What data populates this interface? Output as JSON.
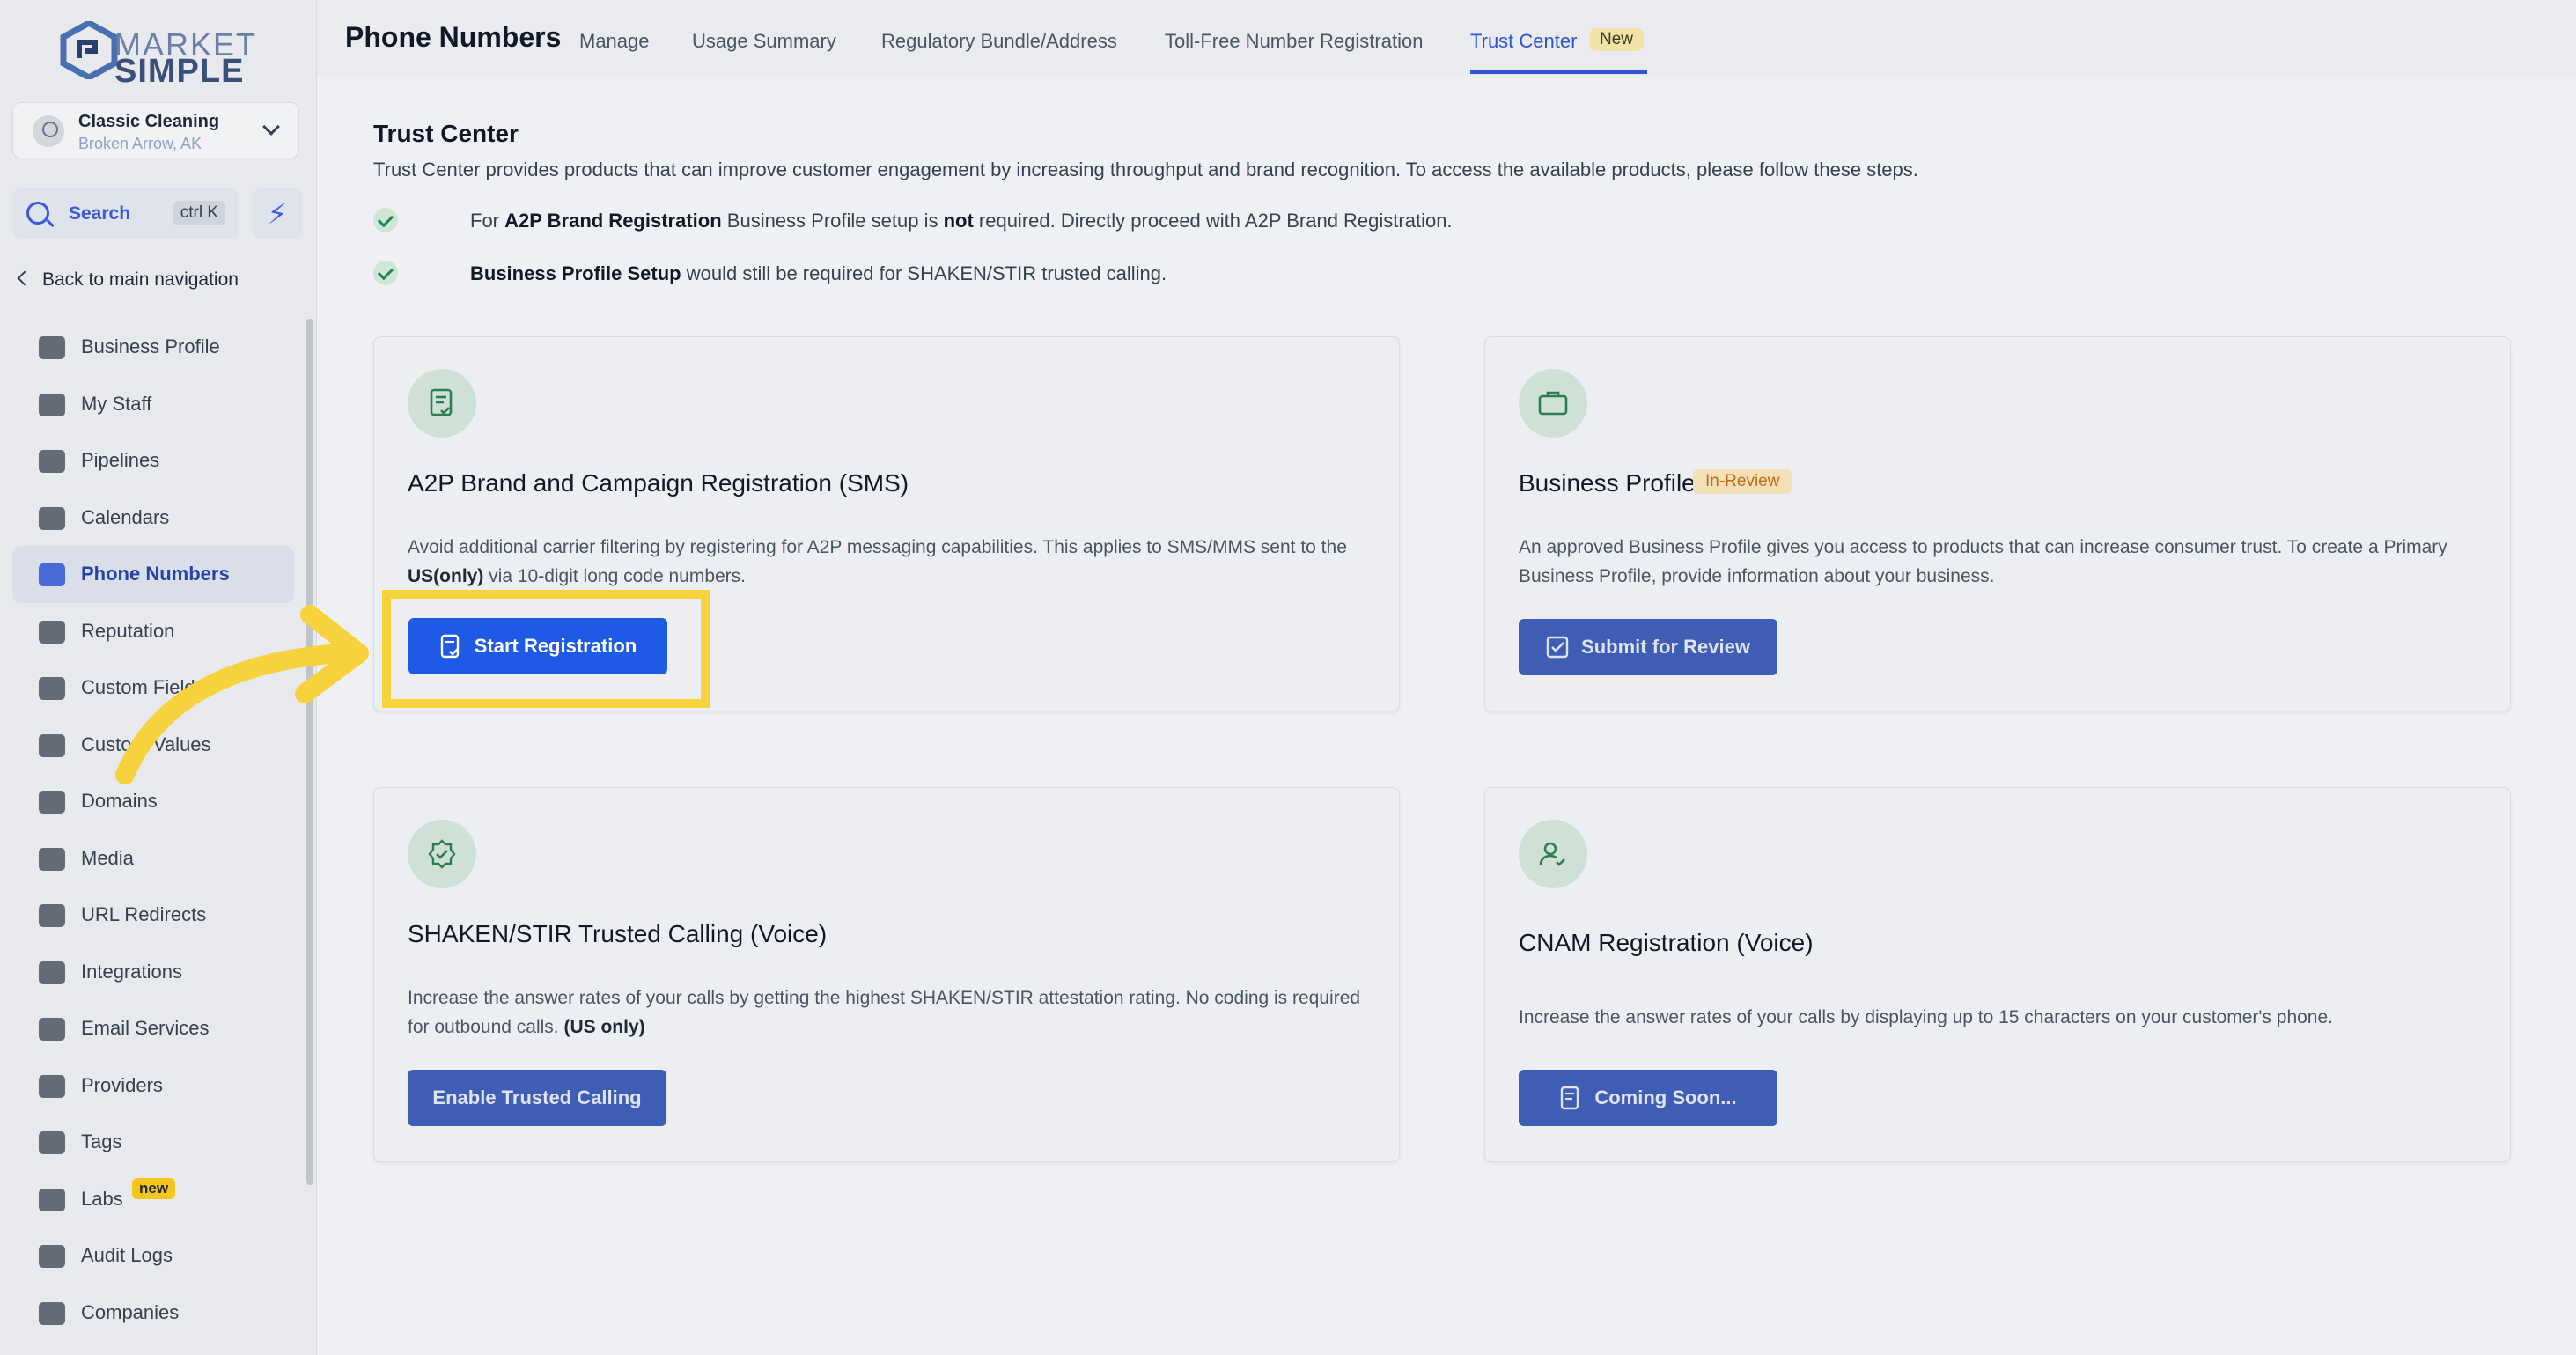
{
  "brand": {
    "line1": "MARKET",
    "line2": "SIMPLE"
  },
  "account": {
    "name": "Classic Cleaning",
    "location": "Broken Arrow, AK"
  },
  "search": {
    "label": "Search",
    "shortcut": "ctrl K"
  },
  "back_label": "Back to main navigation",
  "nav": [
    {
      "label": "Business Profile",
      "icon": "briefcase-icon"
    },
    {
      "label": "My Staff",
      "icon": "user-icon"
    },
    {
      "label": "Pipelines",
      "icon": "filter-icon"
    },
    {
      "label": "Calendars",
      "icon": "calendar-icon"
    },
    {
      "label": "Phone Numbers",
      "icon": "phone-icon",
      "active": true
    },
    {
      "label": "Reputation",
      "icon": "star-icon"
    },
    {
      "label": "Custom Fields",
      "icon": "columns-icon"
    },
    {
      "label": "Custom Values",
      "icon": "tag-icon"
    },
    {
      "label": "Domains",
      "icon": "globe-icon"
    },
    {
      "label": "Media",
      "icon": "media-icon"
    },
    {
      "label": "URL Redirects",
      "icon": "redirect-icon"
    },
    {
      "label": "Integrations",
      "icon": "integration-icon"
    },
    {
      "label": "Email Services",
      "icon": "mail-icon"
    },
    {
      "label": "Providers",
      "icon": "clipboard-icon"
    },
    {
      "label": "Tags",
      "icon": "tags-icon"
    },
    {
      "label": "Labs",
      "icon": "flask-icon",
      "badge": "new"
    },
    {
      "label": "Audit Logs",
      "icon": "chart-icon"
    },
    {
      "label": "Companies",
      "icon": "building-icon"
    }
  ],
  "header": {
    "title": "Phone Numbers",
    "tabs": [
      "Manage",
      "Usage Summary",
      "Regulatory Bundle/Address",
      "Toll-Free Number Registration",
      "Trust Center"
    ],
    "active_tab": "Trust Center",
    "new_badge": "New"
  },
  "trust_center": {
    "title": "Trust Center",
    "description": "Trust Center provides products that can improve customer engagement by increasing throughput and brand recognition. To access the available products, please follow these steps.",
    "checks": [
      {
        "pre": "For ",
        "b1": "A2P Brand Registration",
        "mid": " Business Profile setup is ",
        "b2": "not",
        "post": " required. Directly proceed with A2P Brand Registration."
      },
      {
        "b1": "Business Profile Setup",
        "post": " would still be required for SHAKEN/STIR trusted calling."
      }
    ]
  },
  "cards": {
    "a2p": {
      "title": "A2P Brand and Campaign Registration (SMS)",
      "desc_pre": "Avoid additional carrier filtering by registering for A2P messaging capabilities. This applies to SMS/MMS sent to the ",
      "desc_bold": "US(only)",
      "desc_post": " via 10-digit long code numbers.",
      "button": "Start Registration"
    },
    "business_profile": {
      "title": "Business Profile",
      "status": "In-Review",
      "desc": "An approved Business Profile gives you access to products that can increase consumer trust. To create a Primary Business Profile, provide information about your business.",
      "button": "Submit for Review"
    },
    "shaken": {
      "title": "SHAKEN/STIR Trusted Calling (Voice)",
      "desc_pre": "Increase the answer rates of your calls by getting the highest SHAKEN/STIR attestation rating. No coding is required for outbound calls. ",
      "desc_bold": "(US only)",
      "button": "Enable Trusted Calling"
    },
    "cnam": {
      "title": "CNAM Registration (Voice)",
      "desc": "Increase the answer rates of your calls by displaying up to 15 characters on your customer's phone.",
      "button": "Coming Soon..."
    }
  },
  "colors": {
    "primary": "#1e5ae6",
    "highlight": "#f6d33c",
    "success": "#1f8a4c"
  }
}
